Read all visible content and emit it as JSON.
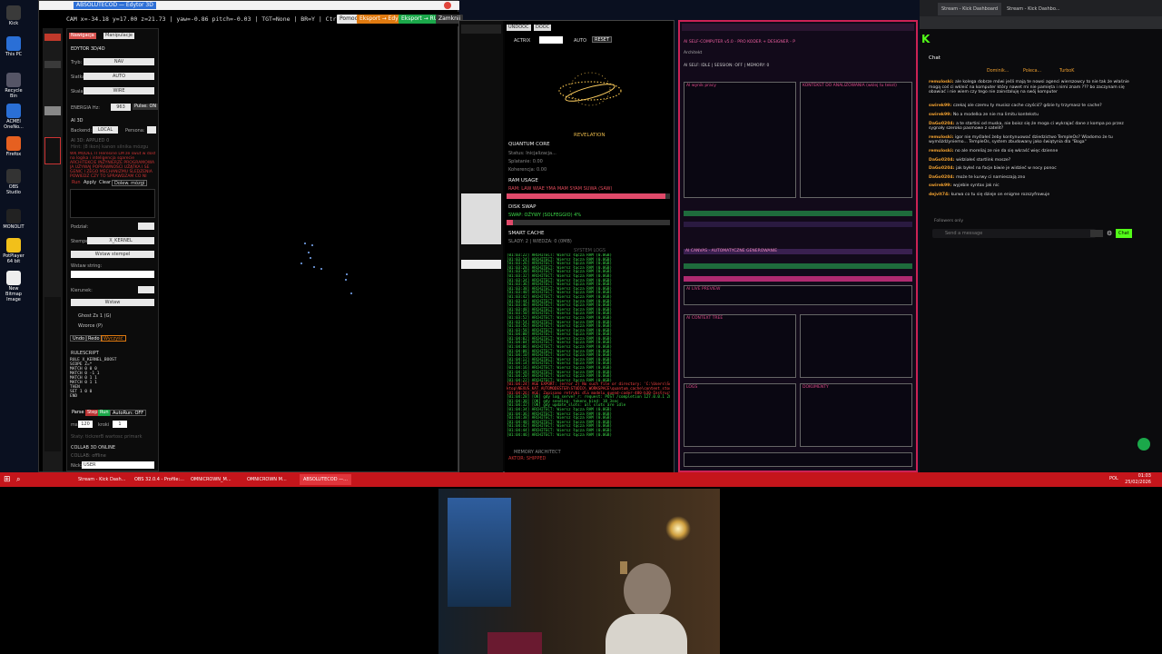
{
  "desktop": {
    "icons": [
      {
        "label": "Kick",
        "color": "#3a3a3a"
      },
      {
        "label": "This PC",
        "color": "#2a6fd6"
      },
      {
        "label": "Recycle Bin",
        "color": "#556"
      },
      {
        "label": "ACMEI OneNo...",
        "color": "#2a6fd6"
      },
      {
        "label": "Firefox",
        "color": "#e66020"
      },
      {
        "label": "OBS Studio",
        "color": "#333"
      },
      {
        "label": "MONOLIT",
        "color": "#222"
      },
      {
        "label": "PotPlayer 64 bit",
        "color": "#f2c01a"
      },
      {
        "label": "New Bitmap Image",
        "color": "#eee"
      }
    ]
  },
  "editor": {
    "title": "ABSOLUTECOD — Edytor 3D",
    "cam_readout": "CAM x=-34.18 y=17.00 z=21.73 | yaw=-0.86 pitch=-0.03 | TGT=None | BR=Y | Ctrl+S eksport",
    "buttons": {
      "pomoc": "Pomoc",
      "export_edytor": "Eksport → Edytor",
      "export_run": "Eksport → RUN",
      "zamknij": "Zamknij"
    },
    "panel": {
      "tab_active": "Nawigacja",
      "tab_other": "Manipulacje",
      "header": "EDYTOR 3D/4D",
      "tryb_label": "Tryb:",
      "tryb_value": "NAV",
      "siatka_label": "Siatka:",
      "siatka_value": "AUTO",
      "skala_label": "Skala:",
      "skala_value": "WIRE",
      "energia_label": "ENERGIA Hz:",
      "energia_value": "963",
      "pulse_label": "Pulse: ON",
      "ai_label": "AI 3D",
      "backend_label": "Backend:",
      "backend_value": "LOCAL",
      "persona_label": "Persona:",
      "ai_status": "AI 3D: APPLIED 0",
      "ai_hint": "Hint: (8 ikon) kanon silnika mózgu",
      "ai_text": "WK MODEL IT Heresine LM ze swut w dost\nna logika i inteligencja sqarecie\nARCHITEKCIE INŻYNIERZE PROGRAMOWA\nJA UŻYWAJ POPRAWNOŚCI UŻĄTKA I SE\nGENIC I ZEGO MECHANIZMU ŚLEDZENIA\nPOWIEDZ CZY TO SPRAWDZAM CO NI",
      "run": "Run",
      "apply": "Apply",
      "clear": "Clear",
      "dolew": "Dolew. mózgi",
      "podzial_label": "Podział:",
      "stempel_label": "Stempel:",
      "stempel_value": "X_KERNEL",
      "wstaw_stempel": "Wstaw stempel",
      "wstaw_string_label": "Wstaw string:",
      "kierunek_label": "Kierunek:",
      "wstaw": "Wstaw",
      "ghost_label": "Ghost Zs 1 (G)",
      "wzorce_label": "Wzorce (P)",
      "undo": "Undo",
      "redo": "Redo",
      "wyczysc": "Wyczyść",
      "rulescript_label": "RULESCRIPT",
      "rulescript": "RULE X_KERNEL_BOOST\nSCOPE Z=*\nMATCH 0 0 0\nMATCH 0 -1 1\nMATCH 0 1 1\nMATCH 0 1 1\nTHEN\nSET 1 0 0\nEND",
      "parse": "Parse",
      "step": "Step",
      "run2": "Run",
      "autorun": "AutoRun: OFF",
      "ms_label": "ms",
      "ms_value": "120",
      "kroki_label": "kroki",
      "kroki_value": "1",
      "stats": "Staty: tickzerB wartosc primark",
      "collab_label": "COLLAB 3D ONLINE",
      "collab_status": "COLLAB: offline",
      "nick_label": "Nick:",
      "nick_value": "USER"
    }
  },
  "monitor": {
    "tabs": [
      "UNDOOC",
      "DOOC"
    ],
    "actrix": "ACTRIX",
    "auto": "AUTO",
    "reset": "RESET",
    "revelation": "REVELATION",
    "quantum_core": "QUANTUM CORE",
    "status_init": "Status: Inicjalizacja...",
    "splatanie": "Splatanie: 0.00",
    "koherencja": "Koherencja: 0.00",
    "ram_usage": "RAM USAGE",
    "ram_line": "RAM: LAW WIAE YMA MAM SYAM SUWA (SAW)",
    "ram_fill": 0.97,
    "disk_swap": "DISK SWAP",
    "swap_line": "SWAP: OŻYWY (SOLFEGGIO) 4%",
    "swap_fill": 0.04,
    "smart_cache": "SMART CACHE",
    "cache_line": "SLADY: 2 | WIEDZA: 0 (0MB)",
    "system_logs": "SYSTEM LOGS",
    "memory": "MEMORY ARCHITECT",
    "memory_status": "AKTOR: SHIPPED",
    "log_lines": [
      {
        "t": "[01:03:22] ARCHITECT: Wiersz łącza RAM (0.0GB)",
        "c": "g"
      },
      {
        "t": "[01:03:24] ARCHITECT: Wiersz łącza RAM (0.0GB)",
        "c": "g"
      },
      {
        "t": "[01:03:26] ARCHITECT: Wiersz łącza RAM (0.0GB)",
        "c": "g"
      },
      {
        "t": "[01:03:28] ARCHITECT: Wiersz łącza RAM (0.0GB)",
        "c": "g"
      },
      {
        "t": "[01:03:30] ARCHITECT: Wiersz łącza RAM (0.0GB)",
        "c": "g"
      },
      {
        "t": "[01:03:32] ARCHITECT: Wiersz łącza RAM (0.0GB)",
        "c": "g"
      },
      {
        "t": "[01:03:34] ARCHITECT: Wiersz łącza RAM (0.0GB)",
        "c": "g"
      },
      {
        "t": "[01:03:36] ARCHITECT: Wiersz łącza RAM (0.0GB)",
        "c": "g"
      },
      {
        "t": "[01:03:38] ARCHITECT: Wiersz łącza RAM (0.0GB)",
        "c": "g"
      },
      {
        "t": "[01:03:40] ARCHITECT: Wiersz łącza RAM (0.0GB)",
        "c": "g"
      },
      {
        "t": "[01:03:42] ARCHITECT: Wiersz łącza RAM (0.0GB)",
        "c": "g"
      },
      {
        "t": "[01:03:44] ARCHITECT: Wiersz łącza RAM (0.0GB)",
        "c": "g"
      },
      {
        "t": "[01:03:46] ARCHITECT: Wiersz łącza RAM (0.0GB)",
        "c": "g"
      },
      {
        "t": "[01:03:48] ARCHITECT: Wiersz łącza RAM (0.0GB)",
        "c": "g"
      },
      {
        "t": "[01:03:50] ARCHITECT: Wiersz łącza RAM (0.0GB)",
        "c": "g"
      },
      {
        "t": "[01:03:52] ARCHITECT: Wiersz łącza RAM (0.0GB)",
        "c": "g"
      },
      {
        "t": "[01:03:54] ARCHITECT: Wiersz łącza RAM (0.0GB)",
        "c": "g"
      },
      {
        "t": "[01:03:56] ARCHITECT: Wiersz łącza RAM (0.0GB)",
        "c": "g"
      },
      {
        "t": "[01:03:58] ARCHITECT: Wiersz łącza RAM (0.0GB)",
        "c": "g"
      },
      {
        "t": "[01:04:00] ARCHITECT: Wiersz łącza RAM (0.0GB)",
        "c": "g"
      },
      {
        "t": "[01:04:02] ARCHITECT: Wiersz łącza RAM (0.0GB)",
        "c": "g"
      },
      {
        "t": "[01:04:04] ARCHITECT: Wiersz łącza RAM (0.0GB)",
        "c": "g"
      },
      {
        "t": "[01:04:06] ARCHITECT: Wiersz łącza RAM (0.0GB)",
        "c": "g"
      },
      {
        "t": "[01:04:08] ARCHITECT: Wiersz łącza RAM (0.0GB)",
        "c": "g"
      },
      {
        "t": "[01:04:10] ARCHITECT: Wiersz łącza RAM (0.0GB)",
        "c": "g"
      },
      {
        "t": "[01:04:12] ARCHITECT: Wiersz łącza RAM (0.0GB)",
        "c": "g"
      },
      {
        "t": "[01:04:14] ARCHITECT: Wiersz łącza RAM (0.0GB)",
        "c": "g"
      },
      {
        "t": "[01:04:16] ARCHITECT: Wiersz łącza RAM (0.0GB)",
        "c": "g"
      },
      {
        "t": "[01:04:18] ARCHITECT: Wiersz łącza RAM (0.0GB)",
        "c": "g"
      },
      {
        "t": "[01:04:20] ARCHITECT: Wiersz łącza RAM (0.0GB)",
        "c": "g"
      },
      {
        "t": "[01:04:22] ARCHITECT: Wiersz łącza RAM (0.0GB)",
        "c": "g"
      },
      {
        "t": "[01:04:24] AGE EXPORT: (error 2) No such file or directory: 'C:\\Users\\Socik\\Des",
        "c": "r"
      },
      {
        "t": "ktop\\NEXUS_KAT_AUTOMODESTER\\STUDIO\\_WORKSPACE\\quantum_cache\\content_store.mem'",
        "c": "r"
      },
      {
        "t": "[01:04:26] AGE: Zapisano retrybi dla modelu quend-coder-480-b30-Instruct-Q5_K_M",
        "c": "r"
      },
      {
        "t": "[01:04:28] [OK] gdy log_server_r: request: POST /completion 127.0.0.1 200",
        "c": "g"
      },
      {
        "t": "[01:04:30] [OK] gdy sending: tokens kind: 18_3sec",
        "c": "g"
      },
      {
        "t": "[01:04:32] [OK] gdy update_slots: all slots are idle",
        "c": "g"
      },
      {
        "t": "[01:04:34] ARCHITECT: Wiersz łącza RAM (0.0GB)",
        "c": "g"
      },
      {
        "t": "[01:04:36] ARCHITECT: Wiersz łącza RAM (0.0GB)",
        "c": "g"
      },
      {
        "t": "[01:04:38] ARCHITECT: Wiersz łącza RAM (0.0GB)",
        "c": "g"
      },
      {
        "t": "[01:04:40] ARCHITECT: Wiersz łącza RAM (0.0GB)",
        "c": "g"
      },
      {
        "t": "[01:04:42] ARCHITECT: Wiersz łącza RAM (0.0GB)",
        "c": "g"
      },
      {
        "t": "[01:04:44] ARCHITECT: Wiersz łącza RAM (0.0GB)",
        "c": "g"
      },
      {
        "t": "[01:04:46] ARCHITECT: Wiersz łącza RAM (0.0GB)",
        "c": "g"
      }
    ]
  },
  "dashboard": {
    "title": "AI SELF-COMPUTER v5.0 - PRO KODER + DESIGNER - P",
    "subtitle": "Architekt",
    "status": "AI SELF: IDLE | SESSION: OFF | MEMORY: 0",
    "panel_a": "AI wynik pracy",
    "panel_b": "KONTEKST DO ANALIZOWANIA (wklej tu tekst)",
    "strip_a": "AI CANVAS - AUTOMATYCZNE GENEROWANIE",
    "panel_c": "AI LIVE PREVIEW",
    "panel_d": "AI CONTEXT TREE",
    "panel_e": "LOGS",
    "panel_f": "DOKUMENTY"
  },
  "browser": {
    "tabs": [
      "Stream - Kick Dashboard",
      "Stream - Kick Dashbo..."
    ],
    "chat_title": "Chat",
    "chat_tags": [
      "Dominik...",
      "Poleca...",
      "TurboK"
    ],
    "messages": [
      {
        "user": "remuloski:",
        "text": "ale kolega dobrze mówi jeśli mają te nowsi agenci wierszowcy to nie tak że właśnie mogą coś ci wkleić na komputer który nawet mi nie pamięta i nimi znam ??? bo zaczynam się obawiać i nie wiem czy tego nie zainstaluję na swój komputer"
      },
      {
        "user": "swirek99:",
        "text": "czekaj ale czemu ty musisz cache czyścić? gdzie ty trzymasz te cache?"
      },
      {
        "user": "swirek99:",
        "text": "No a modelka ze nie ma limitu kontekstu"
      },
      {
        "user": "DaGo0204:",
        "text": "a te startini od muska, nie boisz się że moga ci wykrajać dane z kompa po przez sygnały szeroko pasmowe z satelit?"
      },
      {
        "user": "remuloski:",
        "text": "igor nie myślałeś żeby kontynuować dziedzictwo TempleOs? Wiadomo że tu wymóżdżyniemo... TempleOs, system zbudowany jako świątynia dla \"Boga\""
      },
      {
        "user": "remuloski:",
        "text": "no ale moreliaj ze nie da się wkraść więc dzienne"
      },
      {
        "user": "DaGo0204:",
        "text": "widziałeś startlink mosze?"
      },
      {
        "user": "DaGo0204:",
        "text": "jak byłeś na facje biwie je widzieć w nocy ponoc"
      },
      {
        "user": "DaGo0204:",
        "text": "może te kurwy ci namieszają zno"
      },
      {
        "user": "swirek99:",
        "text": "wyjebie syntax jak nic"
      },
      {
        "user": "dejvit74:",
        "text": "kurwa co tu się dzieje on enigme rozszyfrowuje"
      }
    ],
    "followers_only": "Followers only",
    "send_placeholder": "Send a message",
    "chat_button": "Chat"
  },
  "taskbar": {
    "items": [
      "Stream - Kick Dash...",
      "OBS 32.0.4 - Profile:...",
      "OMNICROWN_M...",
      "OMNICROWN M...",
      "ABSOLUTECOD —..."
    ],
    "time": "01:03",
    "date": "25/02/2026",
    "lang": "POL"
  }
}
